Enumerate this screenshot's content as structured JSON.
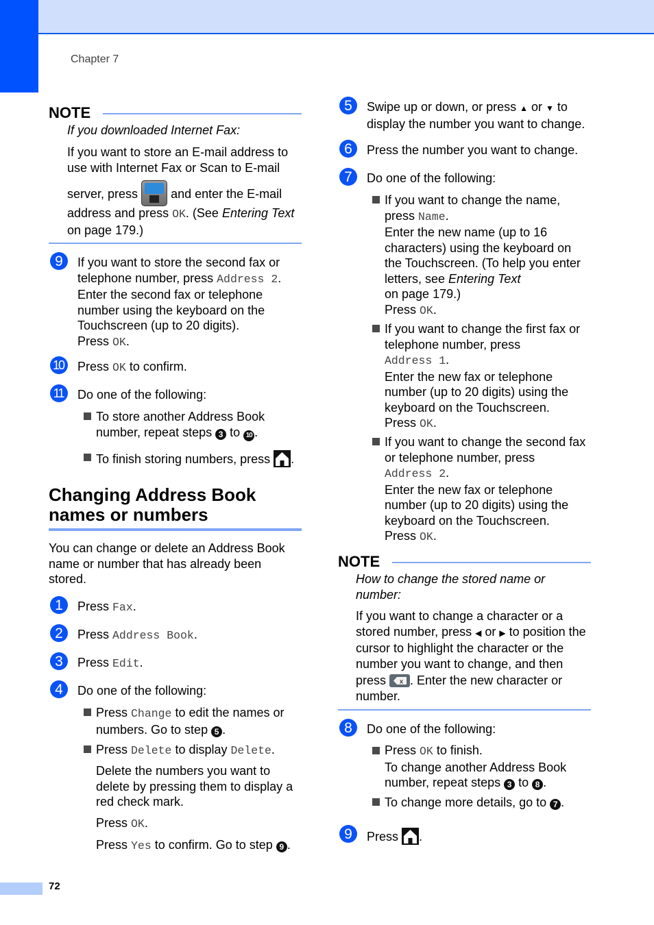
{
  "header": {
    "chapter": "Chapter 7"
  },
  "footer": {
    "page_number": "72"
  },
  "left": {
    "note1": {
      "title": "NOTE",
      "subtitle": "If you downloaded Internet Fax:",
      "p1_line1": "If you want to store an E-mail address to",
      "p1_line2": "use with Internet Fax or Scan to E-mail",
      "p1_line3a": "server, press",
      "p1_line3b": "and enter the E-mail",
      "p1_line4a": "address and press ",
      "p1_ok": "OK",
      "p1_line4b": ". (See ",
      "p1_link": "Entering Text",
      "p1_line5": "on page 179.)",
      "icon": "fax-email-icon"
    },
    "step9": {
      "num": "9",
      "l1": "If you want to store the second fax or",
      "l2a": "telephone number, press ",
      "l2code": "Address 2",
      "l3": "Enter the second fax or telephone",
      "l4": "number using the keyboard on the",
      "l5": "Touchscreen (up to 20 digits).",
      "l6a": "Press ",
      "l6code": "OK"
    },
    "step10": {
      "num": "10",
      "a": "Press ",
      "code": "OK",
      "b": " to confirm."
    },
    "step11": {
      "num": "11",
      "text": "Do one of the following:",
      "b1_l1": "To store another Address Book",
      "b1_l2a": "number, repeat steps ",
      "b1_ref1": "3",
      "b1_to": " to ",
      "b1_ref2": "10",
      "b2": "To finish storing numbers, press"
    },
    "section": {
      "title_l1": "Changing Address Book",
      "title_l2": "names or numbers",
      "intro_l1": "You can change or delete an Address Book",
      "intro_l2": "name or number that has already been",
      "intro_l3": "stored."
    },
    "steps": [
      {
        "num": "1",
        "a": "Press ",
        "code": "Fax"
      },
      {
        "num": "2",
        "a": "Press ",
        "code": "Address Book"
      },
      {
        "num": "3",
        "a": "Press ",
        "code": "Edit"
      }
    ],
    "step4": {
      "num": "4",
      "text": "Do one of the following:",
      "b1_a": "Press ",
      "b1_code": "Change",
      "b1_b": " to edit the names or",
      "b1_l2": "numbers. Go to step ",
      "b1_ref": "5",
      "b2_a": "Press ",
      "b2_code": "Delete",
      "b2_b": " to display ",
      "b2_code2": "Delete",
      "p1_l1": "Delete the numbers you want to",
      "p1_l2": "delete by pressing them to display a",
      "p1_l3": "red check mark.",
      "p2_a": "Press ",
      "p2_code": "OK",
      "p3_a": "Press ",
      "p3_code": "Yes",
      "p3_b": " to confirm. Go to step ",
      "p3_ref": "9"
    }
  },
  "right": {
    "step5": {
      "num": "5",
      "l1a": "Swipe up or down, or press ",
      "up": "▲",
      "or": " or ",
      "down": "▼",
      "l1b": " to",
      "l2": "display the number you want to change."
    },
    "step6": {
      "num": "6",
      "text": "Press the number you want to change."
    },
    "step7": {
      "num": "7",
      "text": "Do one of the following:",
      "b1": {
        "l1": "If you want to change the name,",
        "l2a": "press ",
        "l2code": "Name",
        "l3": "Enter the new name (up to 16",
        "l4": "characters) using the keyboard on",
        "l5": "the Touchscreen. (To help you enter",
        "l6a": "letters, see ",
        "l6link": "Entering Text",
        "l7": "on page 179.)",
        "l8a": "Press ",
        "l8code": "OK"
      },
      "b2": {
        "l1": "If you want to change the first fax or",
        "l2": "telephone number, press",
        "l3code": "Address 1",
        "l4": "Enter the new fax or telephone",
        "l5": "number (up to 20 digits) using the",
        "l6": "keyboard on the Touchscreen.",
        "l7a": "Press ",
        "l7code": "OK"
      },
      "b3": {
        "l1": "If you want to change the second fax",
        "l2": "or telephone number, press",
        "l3code": "Address 2",
        "l4": "Enter the new fax or telephone",
        "l5": "number (up to 20 digits) using the",
        "l6": "keyboard on the Touchscreen.",
        "l7a": "Press ",
        "l7code": "OK"
      }
    },
    "note2": {
      "title": "NOTE",
      "sub_l1": "How to change the stored name or",
      "sub_l2": "number:",
      "l1": "If you want to change a character or a",
      "l2a": "stored number, press ",
      "left": "◀",
      "or": " or ",
      "right": "▶",
      "l2b": " to position the",
      "l3": "cursor to highlight the character or the",
      "l4": "number you want to change, and then",
      "l5a": "press ",
      "l5b": ". Enter the new character or",
      "l6": "number."
    },
    "step8": {
      "num": "8",
      "text": "Do one of the following:",
      "b1_a": "Press ",
      "b1_code": "OK",
      "b1_b": " to finish.",
      "b1_l2": "To change another Address Book",
      "b1_l3a": "number, repeat steps ",
      "b1_ref1": "3",
      "b1_to": " to ",
      "b1_ref2": "8",
      "b2_a": "To change more details, go to ",
      "b2_ref": "7"
    },
    "step9": {
      "num": "9",
      "a": "Press "
    }
  },
  "colors": {
    "accent": "#0052ff",
    "header_band": "#cfdffc",
    "rule": "#7ea6f4",
    "step_circle": "#0a52f5"
  }
}
